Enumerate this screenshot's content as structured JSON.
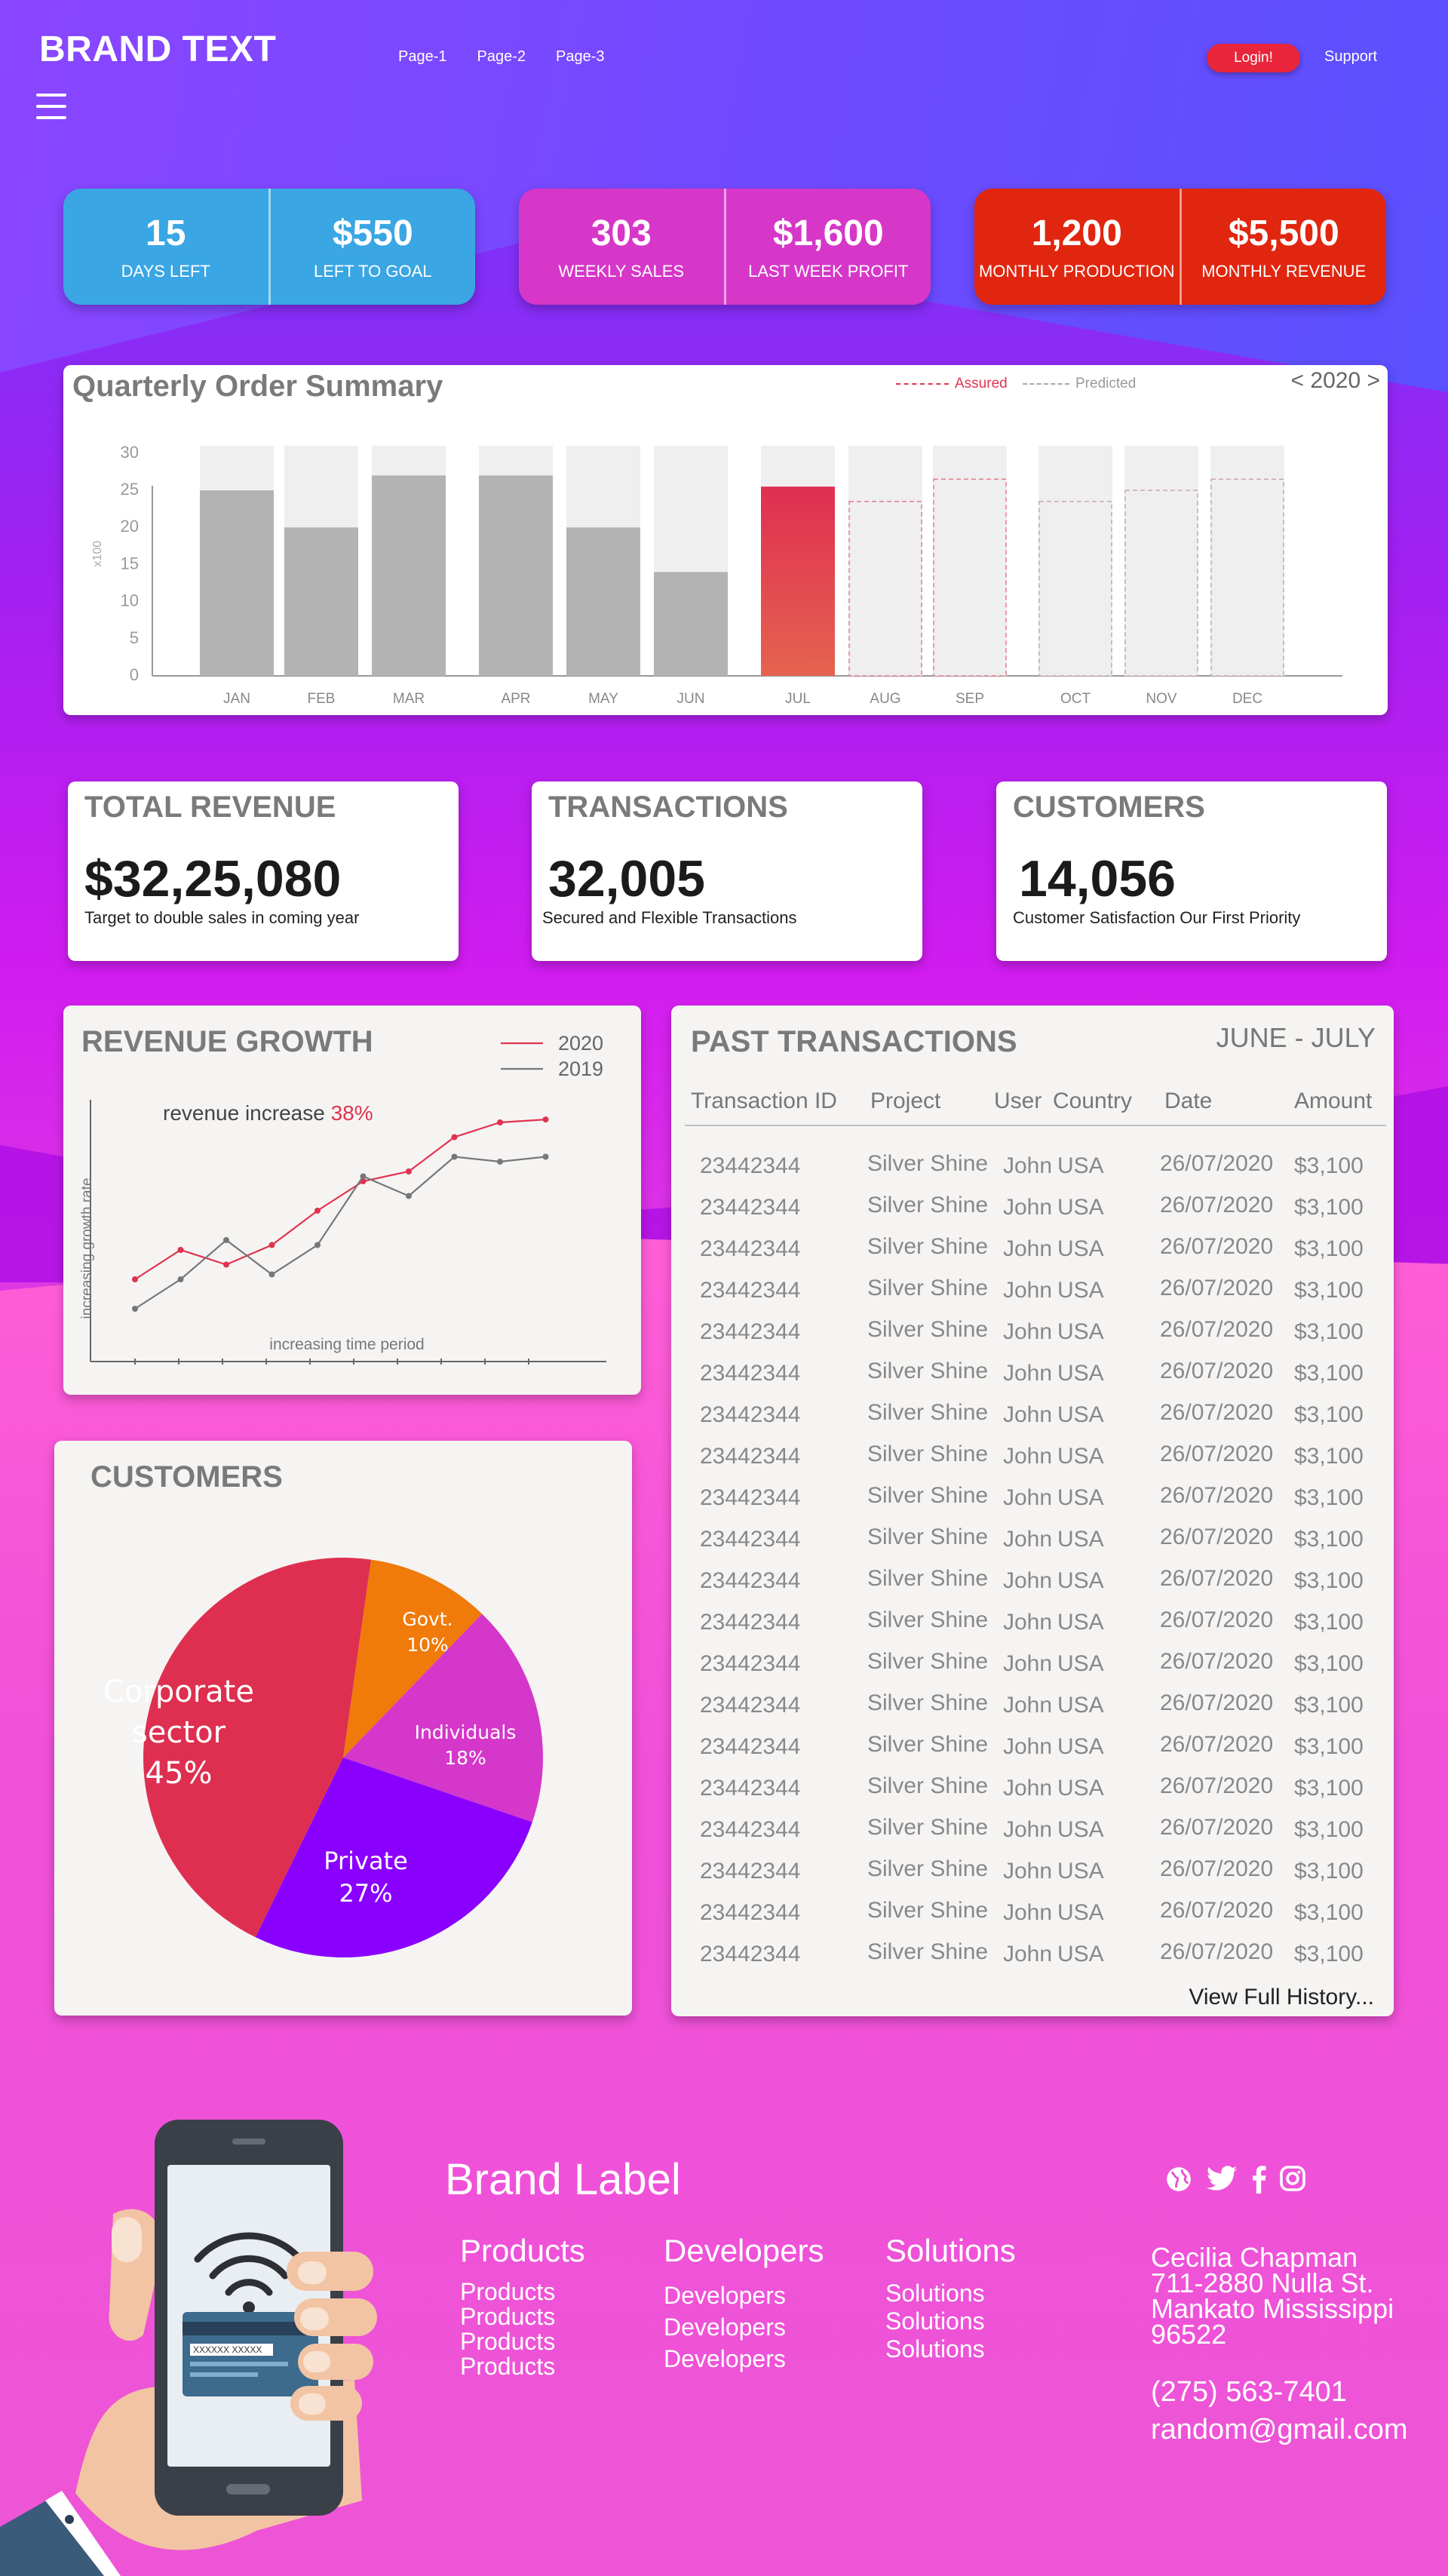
{
  "header": {
    "brand": "BRAND TEXT",
    "nav": [
      "Page-1",
      "Page-2",
      "Page-3"
    ],
    "login_label": "Login!",
    "support_label": "Support"
  },
  "stats": [
    {
      "value": "15",
      "label": "DAYS LEFT"
    },
    {
      "value": "$550",
      "label": "LEFT TO GOAL"
    },
    {
      "value": "303",
      "label": "WEEKLY SALES"
    },
    {
      "value": "$1,600",
      "label": "LAST WEEK PROFIT"
    },
    {
      "value": "1,200",
      "label": "MONTHLY PRODUCTION"
    },
    {
      "value": "$5,500",
      "label": "MONTHLY REVENUE"
    }
  ],
  "colors": {
    "tile1": "#3aa6e3",
    "tile2": "#d637c8",
    "tile3": "#e1260f",
    "assured": "#e0334f",
    "predicted": "#aaaaaa"
  },
  "quarterly": {
    "title": "Quarterly Order Summary",
    "legend_assured": "Assured",
    "legend_predicted": "Predicted",
    "year": "< 2020 >"
  },
  "kpis": [
    {
      "title": "TOTAL REVENUE",
      "value": "$32,25,080",
      "sub": "Target to double sales in coming year"
    },
    {
      "title": "TRANSACTIONS",
      "value": "32,005",
      "sub": "Secured and Flexible Transactions"
    },
    {
      "title": "CUSTOMERS",
      "value": "14,056",
      "sub": "Customer Satisfaction Our First Priority"
    }
  ],
  "revenue": {
    "title": "REVENUE GROWTH",
    "annotation": "revenue increase ",
    "annotation_pct": "38%"
  },
  "transactions": {
    "title": "PAST TRANSACTIONS",
    "period": "JUNE - JULY",
    "columns": [
      "Transaction ID",
      "Project",
      "User",
      "Country",
      "Date",
      "Amount"
    ],
    "rows": [
      [
        "23442344",
        "Silver Shine",
        "John",
        "USA",
        "26/07/2020",
        "$3,100"
      ],
      [
        "23442344",
        "Silver Shine",
        "John",
        "USA",
        "26/07/2020",
        "$3,100"
      ],
      [
        "23442344",
        "Silver Shine",
        "John",
        "USA",
        "26/07/2020",
        "$3,100"
      ],
      [
        "23442344",
        "Silver Shine",
        "John",
        "USA",
        "26/07/2020",
        "$3,100"
      ],
      [
        "23442344",
        "Silver Shine",
        "John",
        "USA",
        "26/07/2020",
        "$3,100"
      ],
      [
        "23442344",
        "Silver Shine",
        "John",
        "USA",
        "26/07/2020",
        "$3,100"
      ],
      [
        "23442344",
        "Silver Shine",
        "John",
        "USA",
        "26/07/2020",
        "$3,100"
      ],
      [
        "23442344",
        "Silver Shine",
        "John",
        "USA",
        "26/07/2020",
        "$3,100"
      ],
      [
        "23442344",
        "Silver Shine",
        "John",
        "USA",
        "26/07/2020",
        "$3,100"
      ],
      [
        "23442344",
        "Silver Shine",
        "John",
        "USA",
        "26/07/2020",
        "$3,100"
      ],
      [
        "23442344",
        "Silver Shine",
        "John",
        "USA",
        "26/07/2020",
        "$3,100"
      ],
      [
        "23442344",
        "Silver Shine",
        "John",
        "USA",
        "26/07/2020",
        "$3,100"
      ],
      [
        "23442344",
        "Silver Shine",
        "John",
        "USA",
        "26/07/2020",
        "$3,100"
      ],
      [
        "23442344",
        "Silver Shine",
        "John",
        "USA",
        "26/07/2020",
        "$3,100"
      ],
      [
        "23442344",
        "Silver Shine",
        "John",
        "USA",
        "26/07/2020",
        "$3,100"
      ],
      [
        "23442344",
        "Silver Shine",
        "John",
        "USA",
        "26/07/2020",
        "$3,100"
      ],
      [
        "23442344",
        "Silver Shine",
        "John",
        "USA",
        "26/07/2020",
        "$3,100"
      ],
      [
        "23442344",
        "Silver Shine",
        "John",
        "USA",
        "26/07/2020",
        "$3,100"
      ],
      [
        "23442344",
        "Silver Shine",
        "John",
        "USA",
        "26/07/2020",
        "$3,100"
      ],
      [
        "23442344",
        "Silver Shine",
        "John",
        "USA",
        "26/07/2020",
        "$3,100"
      ]
    ],
    "more_label": "View Full History..."
  },
  "customers_pie": {
    "title": "CUSTOMERS"
  },
  "chart_data": [
    {
      "type": "bar",
      "title": "Quarterly Order Summary",
      "categories": [
        "JAN",
        "FEB",
        "MAR",
        "APR",
        "MAY",
        "JUN",
        "JUL",
        "AUG",
        "SEP",
        "OCT",
        "NOV",
        "DEC"
      ],
      "ylabel": "x100",
      "ylim": [
        0,
        31
      ],
      "yticks": [
        0,
        5,
        10,
        15,
        20,
        25,
        30
      ],
      "series": [
        {
          "name": "Assured",
          "values": [
            25,
            20,
            27,
            27,
            20,
            14,
            25.5,
            null,
            null,
            null,
            null,
            null
          ]
        },
        {
          "name": "Predicted",
          "values": [
            null,
            null,
            null,
            null,
            null,
            null,
            null,
            23.5,
            26.5,
            23.5,
            25,
            26.5
          ]
        }
      ],
      "capacity": 31,
      "legend": "top-right"
    },
    {
      "type": "line",
      "title": "REVENUE GROWTH",
      "xlabel": "increasing time period",
      "ylabel": "increasing growth rate",
      "x": [
        1,
        2,
        3,
        4,
        5,
        6,
        7,
        8,
        9,
        10,
        11
      ],
      "series": [
        {
          "name": "2020",
          "color": "#e0334f",
          "values": [
            3,
            6,
            4.5,
            6.5,
            10,
            13,
            14,
            17.5,
            19,
            19.3,
            null
          ]
        },
        {
          "name": "2019",
          "color": "#777777",
          "values": [
            0,
            3,
            7,
            3.5,
            6.5,
            13.5,
            11.5,
            15.5,
            15,
            15.5,
            null
          ]
        }
      ],
      "ylim": [
        0,
        22
      ],
      "legend": "top-right"
    },
    {
      "type": "pie",
      "title": "CUSTOMERS",
      "slices": [
        {
          "label": "Govt.",
          "value": 10,
          "color": "#f07a0a"
        },
        {
          "label": "Individuals",
          "value": 18,
          "color": "#d437c9"
        },
        {
          "label": "Private",
          "value": 27,
          "color": "#8a00ff"
        },
        {
          "label": "Corporate sector",
          "value": 45,
          "color": "#de2f50"
        }
      ]
    }
  ],
  "footer": {
    "brand": "Brand Label",
    "columns": [
      {
        "heading": "Products",
        "items": [
          "Products",
          "Products",
          "Products",
          "Products"
        ]
      },
      {
        "heading": "Developers",
        "items": [
          "Developers",
          "Developers",
          "Developers"
        ]
      },
      {
        "heading": "Solutions",
        "items": [
          "Solutions",
          "Solutions",
          "Solutions"
        ]
      }
    ],
    "address": [
      "Cecilia Chapman",
      "711-2880 Nulla St.",
      "Mankato Mississippi",
      "96522"
    ],
    "phone": "(275) 563-7401",
    "email": "random@gmail.com",
    "card_text": "XXXXXX XXXXX",
    "social_icons": [
      "globe-icon",
      "twitter-icon",
      "facebook-icon",
      "instagram-icon"
    ]
  }
}
